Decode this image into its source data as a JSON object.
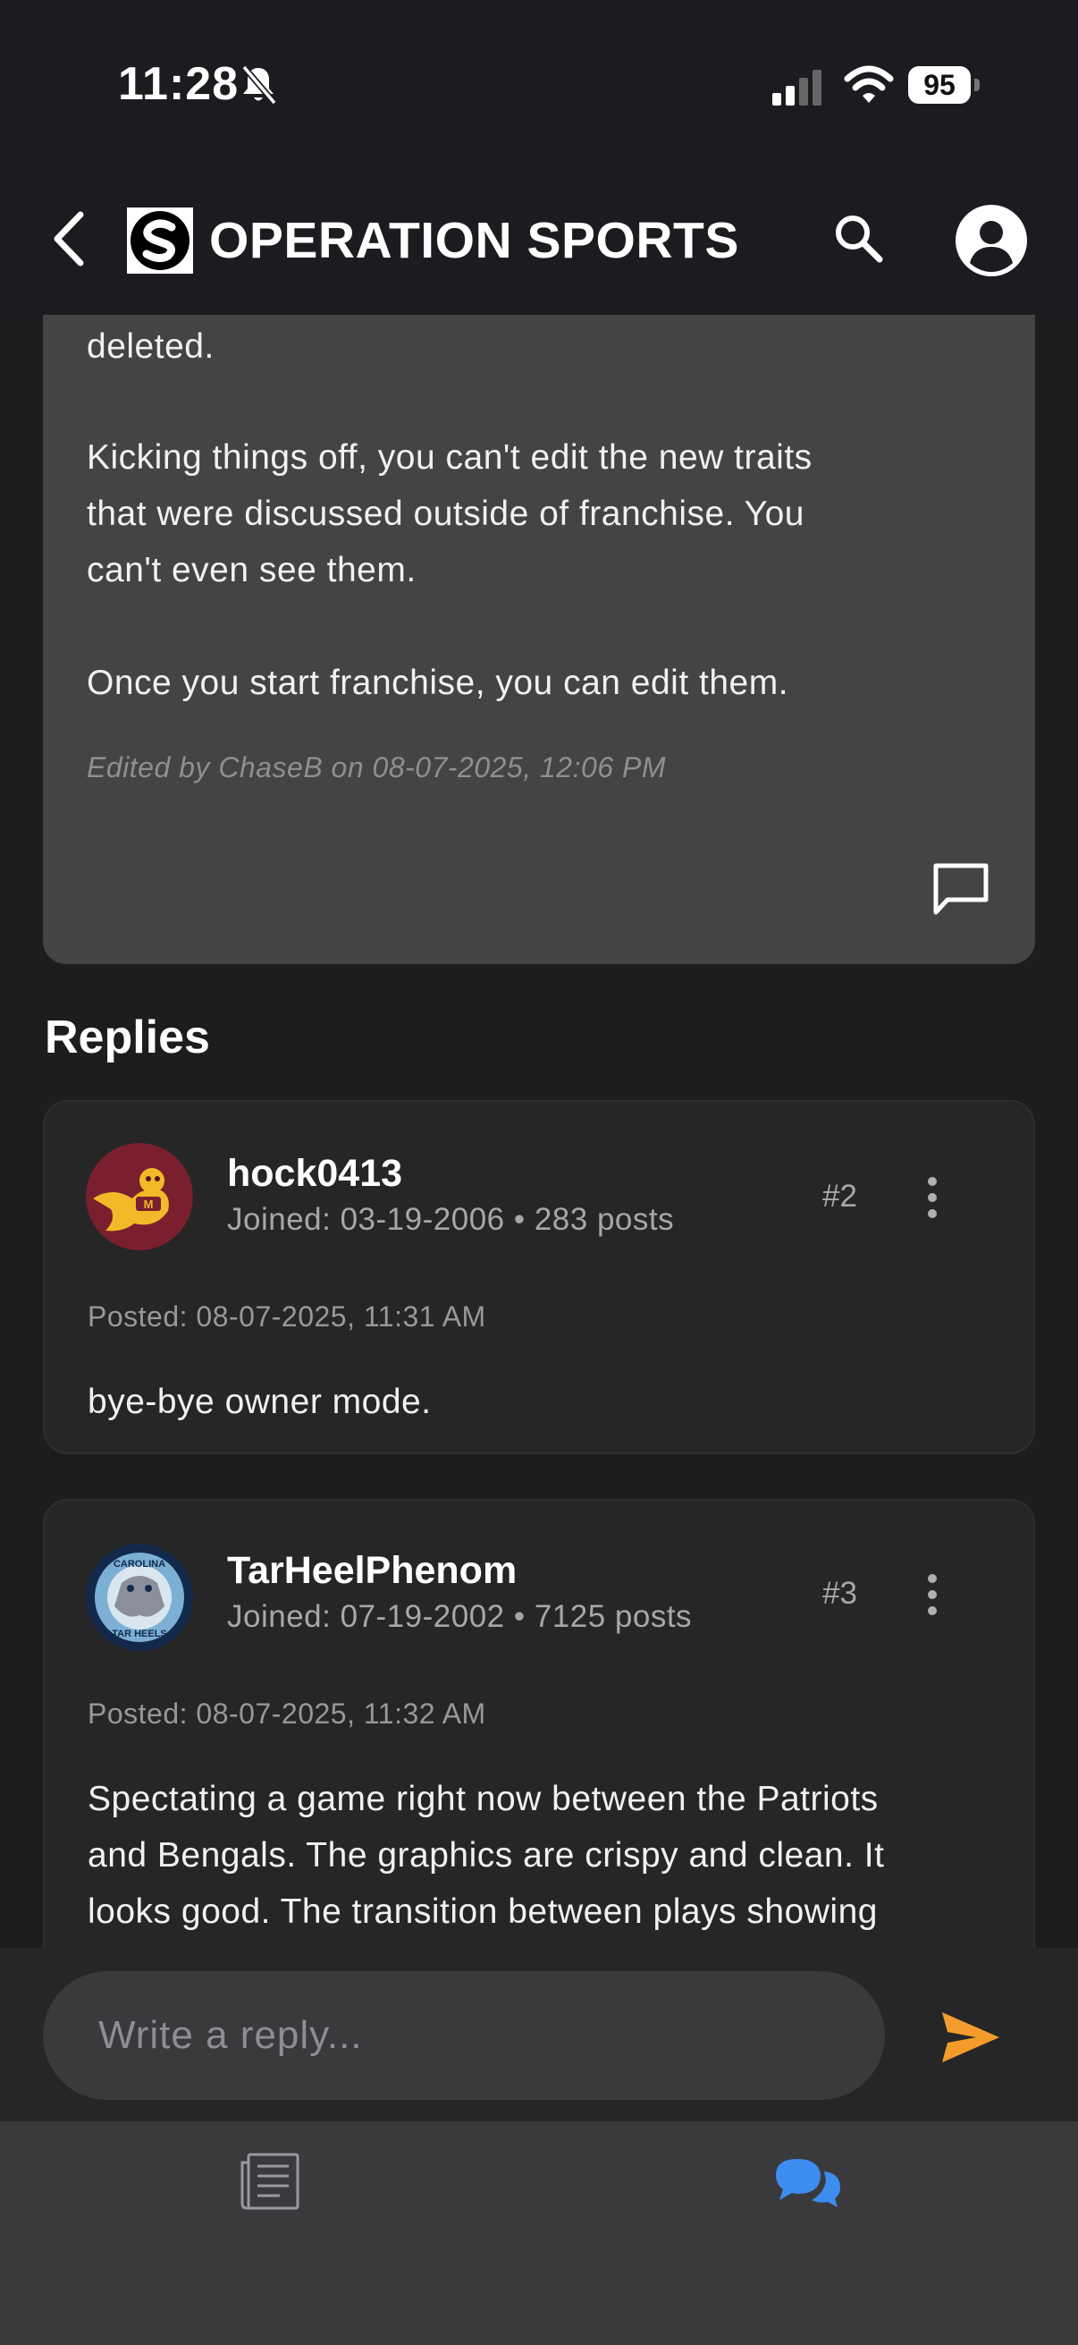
{
  "status": {
    "time": "11:28",
    "battery": "95"
  },
  "header": {
    "brand": "OPERATION SPORTS"
  },
  "op": {
    "lines": [
      "deleted.",
      "Kicking things off, you can't edit the new traits",
      "that were discussed outside of franchise. You",
      "can't even see them.",
      "Once you start franchise, you can edit them."
    ],
    "edited": "Edited by ChaseB on 08-07-2025, 12:06 PM"
  },
  "replies_title": "Replies",
  "replies": [
    {
      "username": "hock0413",
      "meta": "Joined: 03-19-2006 • 283 posts",
      "number": "#2",
      "posted": "Posted: 08-07-2025, 11:31 AM",
      "body": [
        "bye-bye owner mode."
      ]
    },
    {
      "username": "TarHeelPhenom",
      "meta": "Joined: 07-19-2002 • 7125 posts",
      "number": "#3",
      "posted": "Posted: 08-07-2025, 11:32 AM",
      "body": [
        "Spectating a game right now between the Patriots",
        "and Bengals. The graphics are crispy and clean. It",
        "looks good. The transition between plays showing"
      ],
      "avatar_text": [
        "CAROLINA",
        "TAR HEELS"
      ]
    }
  ],
  "composer": {
    "placeholder": "Write a reply..."
  },
  "icons": {
    "back": "chevron-left-icon",
    "logo": "operation-sports-logo",
    "search": "search-icon",
    "profile": "account-circle-icon",
    "comment": "comment-icon",
    "more": "more-vertical-icon",
    "send": "send-icon",
    "news": "news-icon",
    "forums": "forum-chat-icon"
  },
  "colors": {
    "accent_send": "#f39c2c",
    "active_nav": "#3d8cf0",
    "background": "#1d1d1f",
    "card": "#444445"
  }
}
